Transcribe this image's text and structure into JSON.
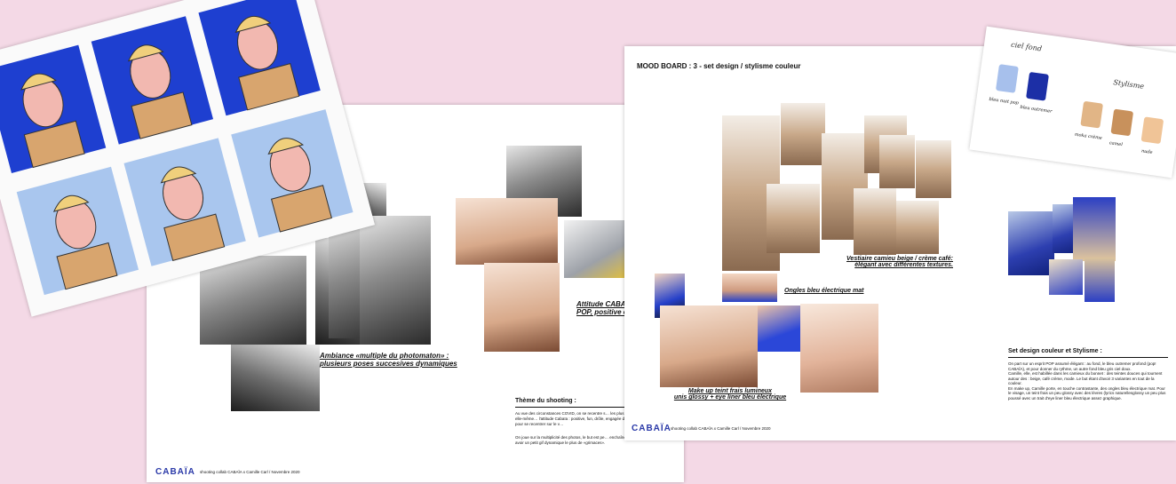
{
  "page1": {
    "caption_photomaton": "Ambiance «multiple du photomaton» :\nplusieurs poses succesives dynamiques",
    "caption_attitude": "Attitude CABAIA\nPOP, positive et d",
    "theme_title": "Thème du shooting :",
    "theme_body_1": "Au vue des circonstances COVID, on se recentre s… les plus importants : le bonnet et Camille elle-même… l'attitude Cabaïa : positive, fun, drôle, engagée d'un… cadrage portrait / épaule, pour se recentrer sur le v…",
    "theme_body_2": "On joue sur la multiplicité des photos, le but est pe… enchaîner les unes après les autres, pour avoir un petit gif dynamique le plus de «grimaces».",
    "logo": "CABAÏA",
    "footer": "shooting collab CABAÏA x Camille Carl / Novembre 2020"
  },
  "page2": {
    "title": "MOOD BOARD : 3 - set design / stylisme couleur",
    "caption_vestiaire": "Vestiaire camieu beige / crème café:\nélégant avec différentes textures.",
    "caption_ongles": "Ongles bleu électrique mat",
    "caption_makeup": "Make up teint frais lumineux\nunis glossy + eye liner bleu électrique",
    "set_design_title": "Set design couleur et Stylisme :",
    "set_design_body": "On part sur un esprit POP assumé élégant : au fond, le bleu outremer profond (pop! CABAÏA), et pour donner du rythme, un autre fond bleu gris ciel doux.\nCamille, elle, est habillée dans les camieux du bonnet : des teintes douces qui tournent autour des : beige, café crème, mode. Le but étant d'avoir 3 variantes en tout de la couleur.\nEn make up, Camille porte, en touche contrastante, des ongles bleu électrique mat. Pour le visage, un teint frais un peu glossy avec des lèvres (lyrics naturellesglossy un peu plus poussé avec un trait d'eye liner bleu électrique assez graphique.",
    "logo": "CABAÏA",
    "footer": "shooting collab CABAÏA x Camille Carl / Novembre 2020",
    "swatch_labels": [
      "bleu nuit pop",
      "bleu outremer",
      "moka crème",
      "camel",
      "nude"
    ],
    "swatch_header_fond": "ciel fond",
    "swatch_header_stylisme": "Stylisme",
    "colors": [
      "#a7c0ec",
      "#1c2fa6",
      "#e1b586",
      "#c8915c",
      "#f0c497"
    ]
  }
}
